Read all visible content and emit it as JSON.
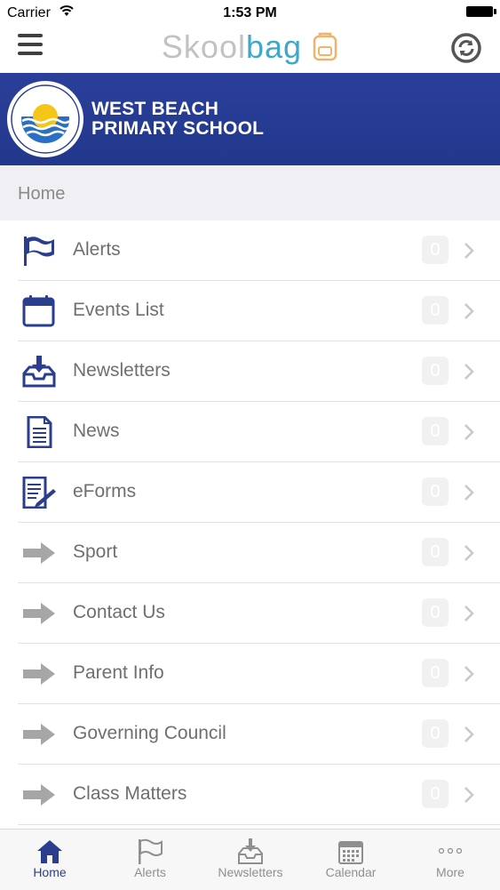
{
  "status": {
    "carrier": "Carrier",
    "time": "1:53 PM"
  },
  "app": {
    "logo_part1": "Skool",
    "logo_part2": "bag"
  },
  "school": {
    "name_line1": "WEST BEACH",
    "name_line2": "PRIMARY SCHOOL"
  },
  "section": {
    "title": "Home"
  },
  "menu": {
    "items": [
      {
        "label": "Alerts",
        "count": "0",
        "icon": "flag-icon"
      },
      {
        "label": "Events List",
        "count": "0",
        "icon": "calendar-icon"
      },
      {
        "label": "Newsletters",
        "count": "0",
        "icon": "inbox-download-icon"
      },
      {
        "label": "News",
        "count": "0",
        "icon": "document-icon"
      },
      {
        "label": "eForms",
        "count": "0",
        "icon": "form-pen-icon"
      },
      {
        "label": "Sport",
        "count": "0",
        "icon": "arrow-right-icon"
      },
      {
        "label": "Contact Us",
        "count": "0",
        "icon": "arrow-right-icon"
      },
      {
        "label": "Parent Info",
        "count": "0",
        "icon": "arrow-right-icon"
      },
      {
        "label": "Governing Council",
        "count": "0",
        "icon": "arrow-right-icon"
      },
      {
        "label": "Class Matters",
        "count": "0",
        "icon": "arrow-right-icon"
      }
    ]
  },
  "tabs": {
    "items": [
      {
        "label": "Home",
        "icon": "home-icon",
        "active": true
      },
      {
        "label": "Alerts",
        "icon": "flag-icon",
        "active": false
      },
      {
        "label": "Newsletters",
        "icon": "inbox-download-icon",
        "active": false
      },
      {
        "label": "Calendar",
        "icon": "calendar-icon",
        "active": false
      },
      {
        "label": "More",
        "icon": "more-dots-icon",
        "active": false
      }
    ]
  },
  "colors": {
    "brand_blue": "#2b3d8f",
    "banner_blue": "#26398f",
    "logo_grey": "#c2c2c2",
    "logo_teal": "#3fa8c8",
    "arrow_grey": "#a6a6a6",
    "label_grey": "#6f6f6f"
  }
}
